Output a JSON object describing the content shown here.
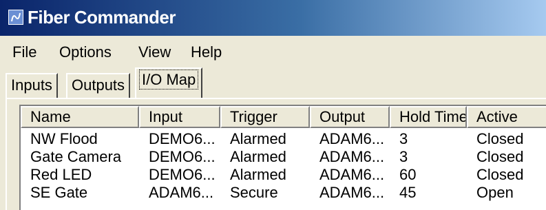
{
  "window": {
    "title": "Fiber Commander"
  },
  "menu": {
    "file": "File",
    "options": "Options",
    "view": "View",
    "help": "Help"
  },
  "tabs": [
    "Inputs",
    "Outputs",
    "I/O Map"
  ],
  "table": {
    "columns": [
      "Name",
      "Input",
      "Trigger",
      "Output",
      "Hold Time",
      "Active"
    ],
    "rows": [
      [
        "NW Flood",
        "DEMO6...",
        "Alarmed",
        "ADAM6...",
        "3",
        "Closed"
      ],
      [
        "Gate Camera",
        "DEMO6...",
        "Alarmed",
        "ADAM6...",
        "3",
        "Closed"
      ],
      [
        "Red LED",
        "DEMO6...",
        "Alarmed",
        "ADAM6...",
        "60",
        "Closed"
      ],
      [
        "SE Gate",
        "ADAM6...",
        "Secure",
        "ADAM6...",
        "45",
        "Open"
      ]
    ]
  }
}
